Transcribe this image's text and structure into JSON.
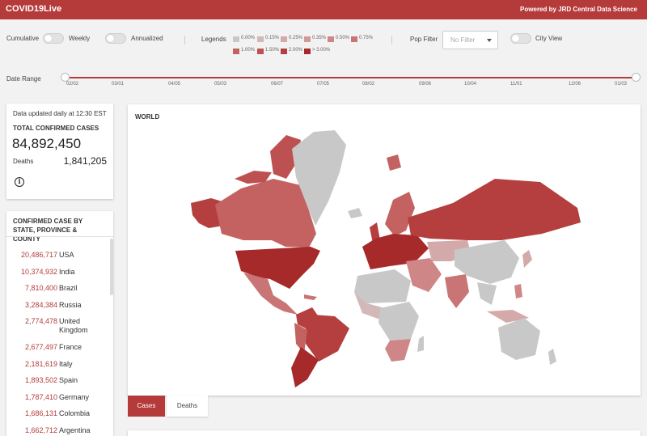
{
  "header": {
    "brand": "COVID19Live",
    "powered_by": "Powered by JRD Central Data Science",
    "bar_color": "#b53a3a"
  },
  "controls": {
    "cumulative_label": "Cumulative",
    "weekly_label": "Weekly",
    "annualized_label": "Annualized",
    "legends_label": "Legends",
    "legend_items": [
      {
        "label": "0.00%",
        "color": "#c8c8c8"
      },
      {
        "label": "0.15%",
        "color": "#d2b8b8"
      },
      {
        "label": "0.25%",
        "color": "#d4a9a9"
      },
      {
        "label": "0.35%",
        "color": "#d39898"
      },
      {
        "label": "0.50%",
        "color": "#cf8686"
      },
      {
        "label": "0.75%",
        "color": "#c97575"
      },
      {
        "label": "1.00%",
        "color": "#c46262"
      },
      {
        "label": "1.50%",
        "color": "#bd5050"
      },
      {
        "label": "2.00%",
        "color": "#b53e3e"
      },
      {
        "label": "> 3.00%",
        "color": "#a72a2a"
      }
    ],
    "pop_filter_label": "Pop Filter",
    "pop_filter_placeholder": "No Filter",
    "city_view_label": "City View",
    "date_range_label": "Date Range",
    "date_ticks": [
      "02/02",
      "03/01",
      "04/05",
      "05/03",
      "06/07",
      "07/05",
      "08/02",
      "09/06",
      "10/04",
      "11/01",
      "12/06",
      "01/03"
    ]
  },
  "summary": {
    "updated_text": "Data updated daily at 12:30 EST",
    "total_label": "TOTAL CONFIRMED CASES",
    "total_value": "84,892,450",
    "deaths_label": "Deaths",
    "deaths_value": "1,841,205",
    "info_icon": "info-icon"
  },
  "by_region": {
    "title": "CONFIRMED CASE BY STATE, PROVINCE & COUNTY",
    "rows": [
      {
        "count": "20,486,717",
        "name": "USA"
      },
      {
        "count": "10,374,932",
        "name": "India"
      },
      {
        "count": "7,810,400",
        "name": "Brazil"
      },
      {
        "count": "3,284,384",
        "name": "Russia"
      },
      {
        "count": "2,774,478",
        "name": "United Kingdom"
      },
      {
        "count": "2,677,497",
        "name": "France"
      },
      {
        "count": "2,181,619",
        "name": "Italy"
      },
      {
        "count": "1,893,502",
        "name": "Spain"
      },
      {
        "count": "1,787,410",
        "name": "Germany"
      },
      {
        "count": "1,686,131",
        "name": "Colombia"
      },
      {
        "count": "1,662,712",
        "name": "Argentina"
      }
    ]
  },
  "map": {
    "title": "WORLD",
    "tabs": [
      {
        "label": "Cases",
        "active": true
      },
      {
        "label": "Deaths",
        "active": false
      }
    ]
  }
}
